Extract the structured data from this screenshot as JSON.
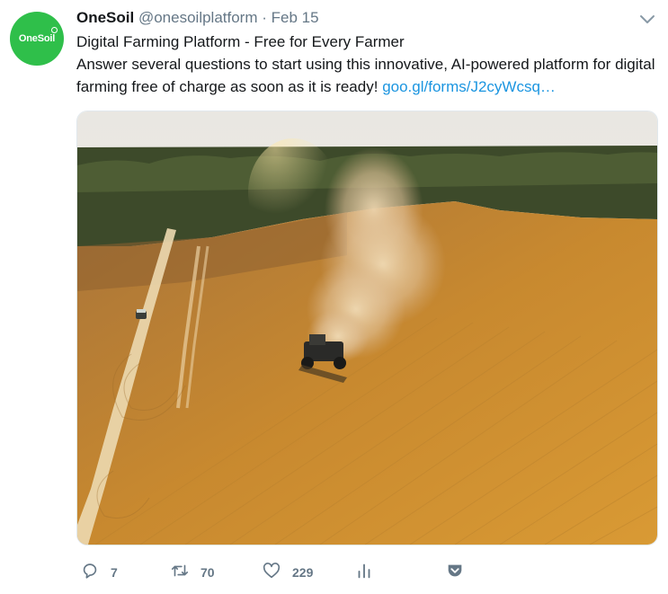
{
  "tweet": {
    "name": "OneSoil",
    "handle": "@onesoilplatform",
    "separator": "·",
    "date": "Feb 15",
    "avatar_text": "OneSoil",
    "line1": "Digital Farming Platform - Free for Every Farmer",
    "line2": "Answer several questions to start using this innovative, AI-powered platform for digital farming free of charge as soon as it is ready!",
    "link": "goo.gl/forms/J2cyWcsq…"
  },
  "actions": {
    "replies": "7",
    "retweets": "70",
    "likes": "229"
  },
  "icons": [
    "chevron-down-icon",
    "reply-icon",
    "retweet-icon",
    "heart-icon",
    "analytics-icon",
    "pocket-icon"
  ],
  "colors": {
    "brand_green": "#2fbf4a",
    "link": "#1b95e0",
    "muted": "#657786",
    "pocket": "#657786"
  }
}
